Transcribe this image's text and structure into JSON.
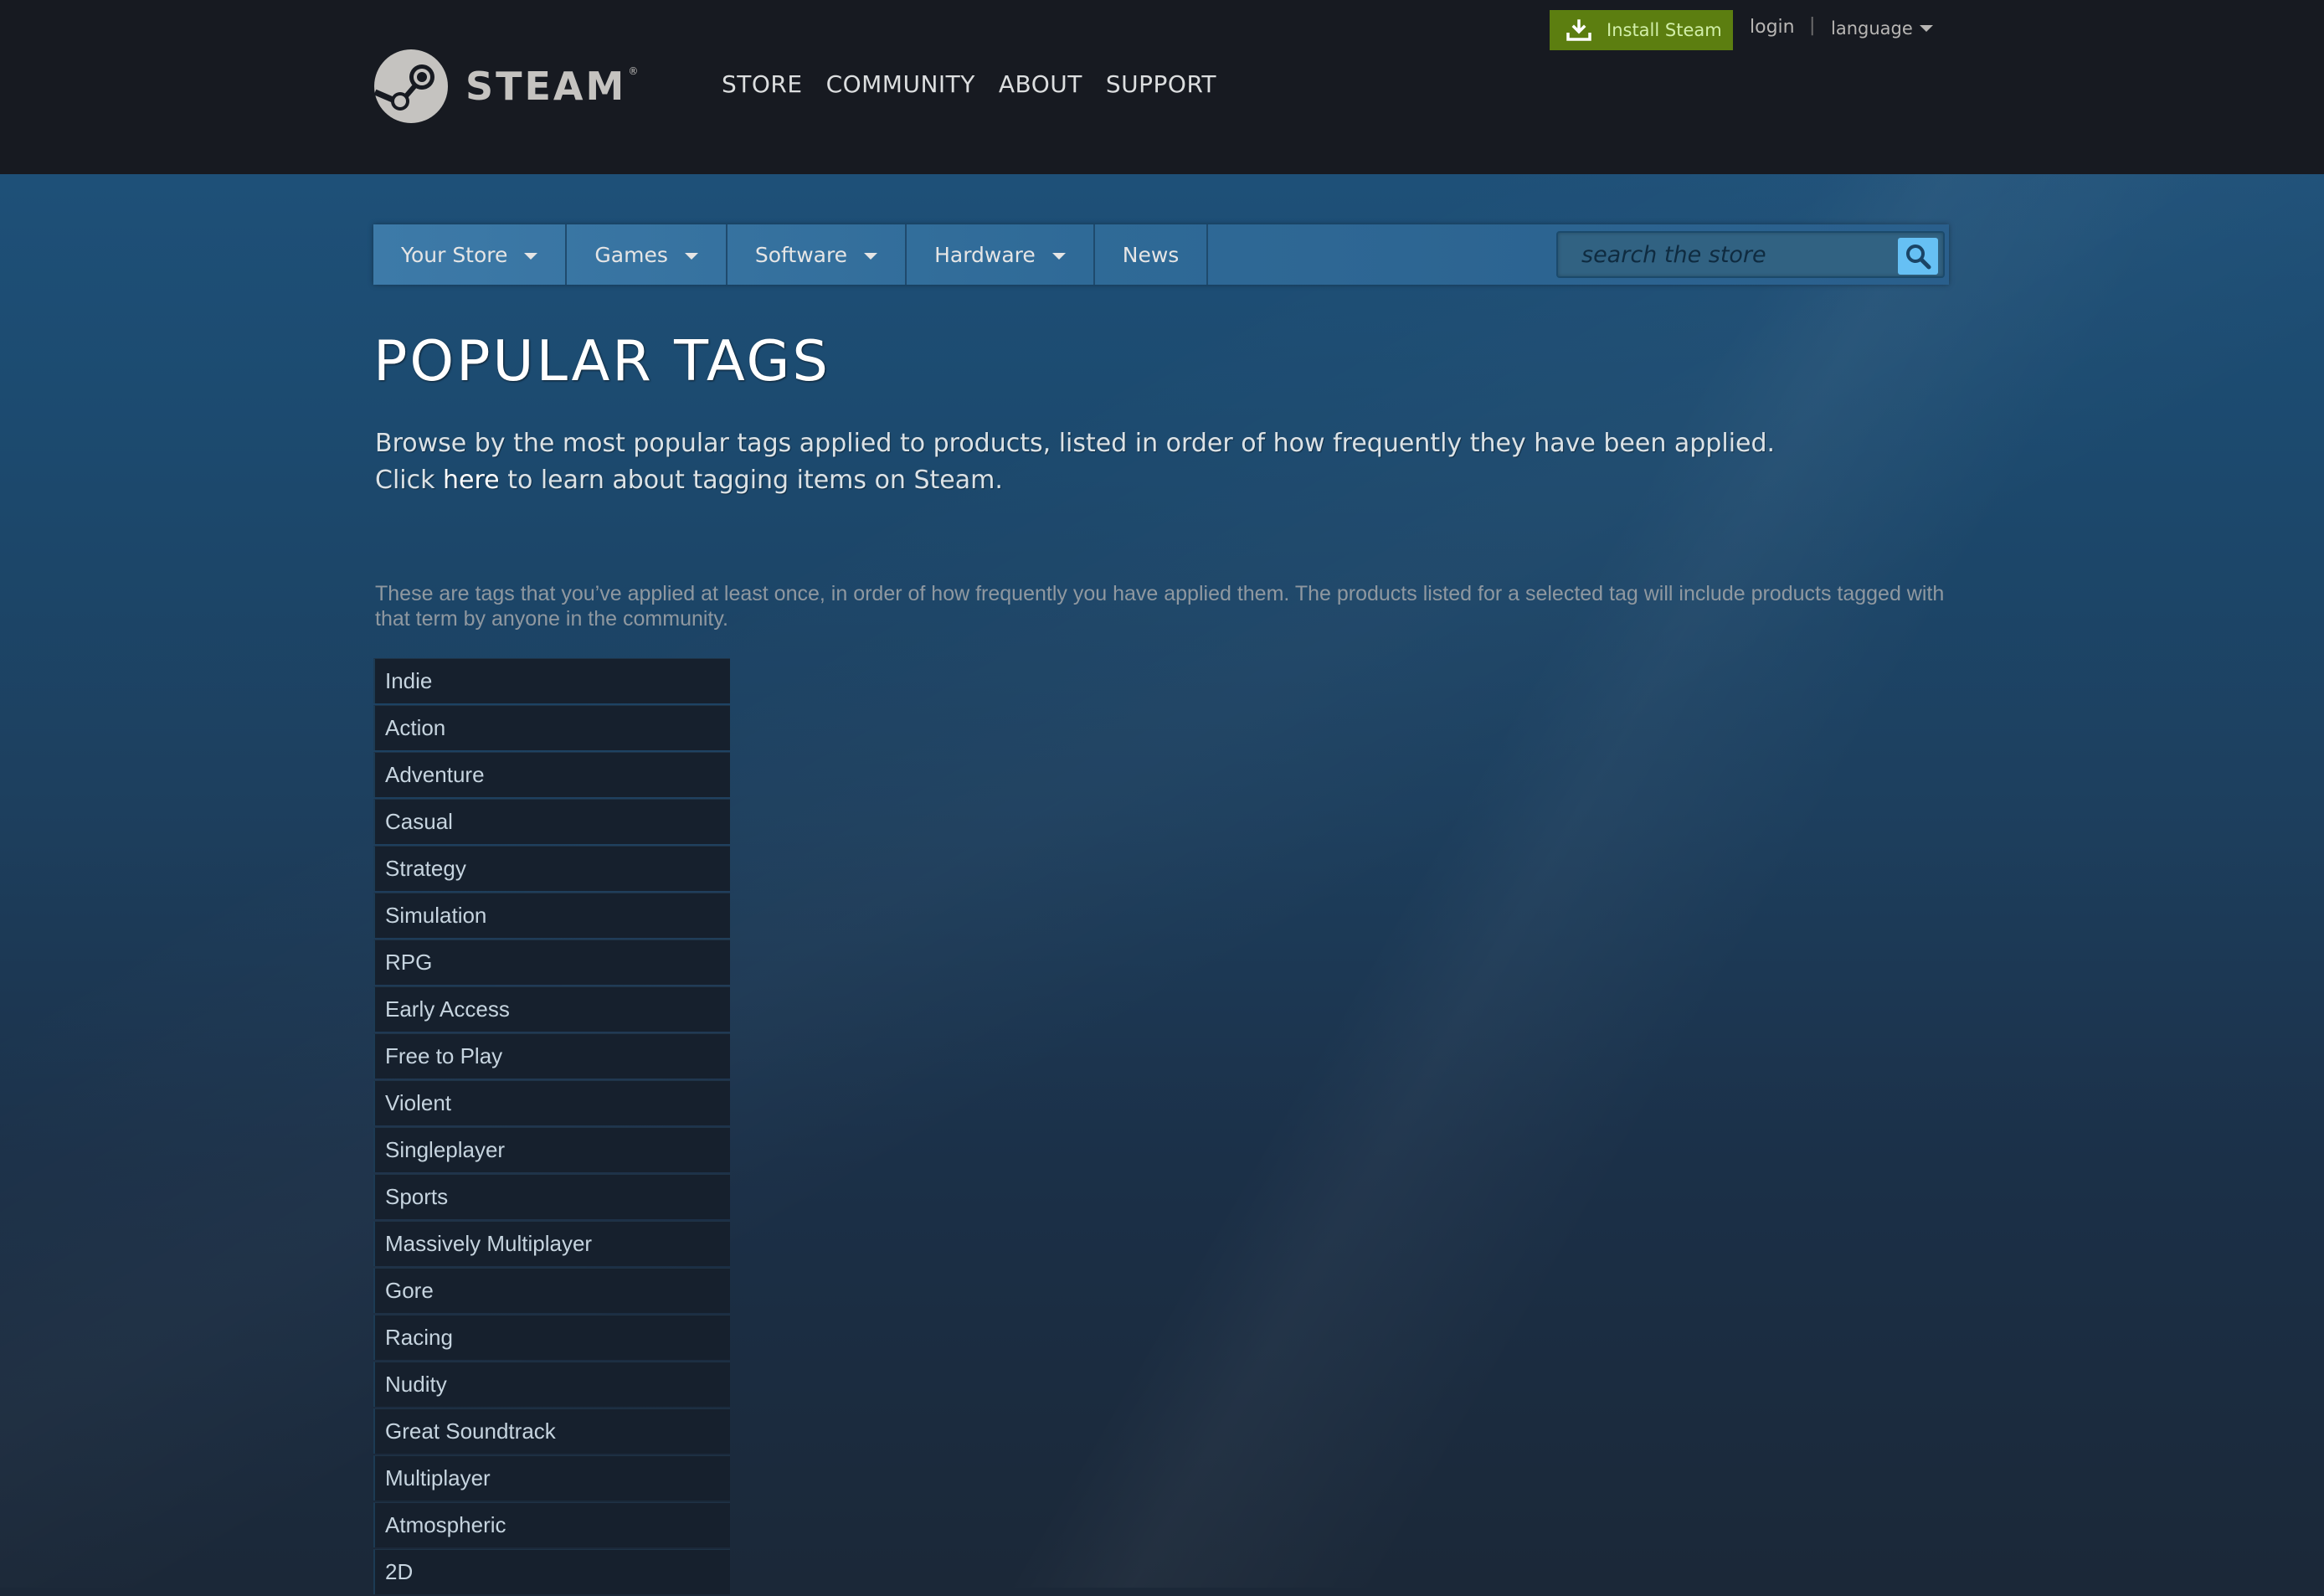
{
  "header": {
    "logo_text": "STEAM",
    "logo_tm": "®",
    "nav": [
      "STORE",
      "COMMUNITY",
      "ABOUT",
      "SUPPORT"
    ],
    "install_label": "Install Steam",
    "login_label": "login",
    "separator": "|",
    "language_label": "language"
  },
  "store_nav": {
    "tabs": [
      {
        "label": "Your Store",
        "dropdown": true
      },
      {
        "label": "Games",
        "dropdown": true
      },
      {
        "label": "Software",
        "dropdown": true
      },
      {
        "label": "Hardware",
        "dropdown": true
      },
      {
        "label": "News",
        "dropdown": false
      }
    ],
    "search_placeholder": "search the store",
    "search_value": ""
  },
  "page": {
    "title": "POPULAR TAGS",
    "description_line1": "Browse by the most popular tags applied to products, listed in order of how frequently they have been applied.",
    "description_click": "Click",
    "description_link": "here",
    "description_rest": "to learn about tagging items on Steam.",
    "user_tags_note": "These are tags that you’ve applied at least once, in order of how frequently you have applied them. The products listed for a selected tag will include products tagged with that term by anyone in the community."
  },
  "tags": [
    "Indie",
    "Action",
    "Adventure",
    "Casual",
    "Strategy",
    "Simulation",
    "RPG",
    "Early Access",
    "Free to Play",
    "Violent",
    "Singleplayer",
    "Sports",
    "Massively Multiplayer",
    "Gore",
    "Racing",
    "Nudity",
    "Great Soundtrack",
    "Multiplayer",
    "Atmospheric",
    "2D"
  ],
  "colors": {
    "header_bg": "#171a21",
    "install_green": "#5c7e10",
    "store_nav_blue": "#3d7aa8",
    "search_button": "#66c0f4",
    "tag_bg": "#16202d"
  },
  "icons": {
    "logo": "steam-logo-icon",
    "install": "download-icon",
    "search": "magnifier-icon",
    "dropdown": "caret-down-icon"
  }
}
